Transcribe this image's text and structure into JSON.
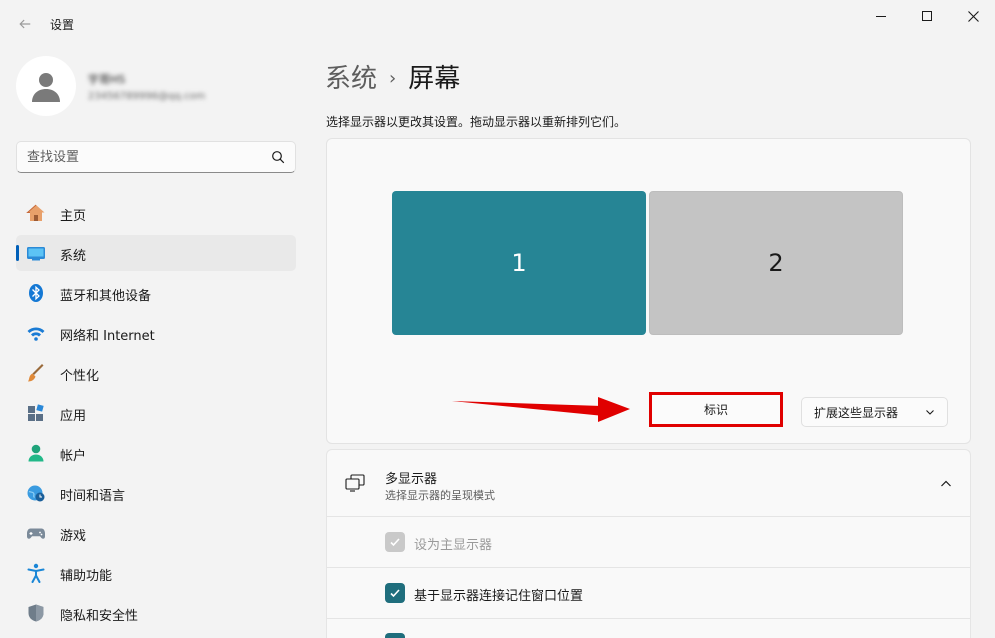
{
  "window": {
    "title": "设置"
  },
  "profile": {
    "name": "宇哥HS",
    "email": "23456789996@qq.com"
  },
  "search": {
    "placeholder": "查找设置"
  },
  "sidebar": {
    "items": [
      {
        "label": "主页",
        "icon": "home-icon"
      },
      {
        "label": "系统",
        "icon": "system-icon",
        "active": true
      },
      {
        "label": "蓝牙和其他设备",
        "icon": "bluetooth-icon"
      },
      {
        "label": "网络和 Internet",
        "icon": "wifi-icon"
      },
      {
        "label": "个性化",
        "icon": "brush-icon"
      },
      {
        "label": "应用",
        "icon": "apps-icon"
      },
      {
        "label": "帐户",
        "icon": "account-icon"
      },
      {
        "label": "时间和语言",
        "icon": "clock-globe-icon"
      },
      {
        "label": "游戏",
        "icon": "gamepad-icon"
      },
      {
        "label": "辅助功能",
        "icon": "accessibility-icon"
      },
      {
        "label": "隐私和安全性",
        "icon": "shield-icon"
      }
    ]
  },
  "breadcrumb": {
    "parent": "系统",
    "separator": "›",
    "current": "屏幕"
  },
  "main": {
    "description": "选择显示器以更改其设置。拖动显示器以重新排列它们。",
    "monitors": [
      {
        "label": "1",
        "selected": true,
        "color": "#268595"
      },
      {
        "label": "2",
        "selected": false,
        "color": "#c4c4c4"
      }
    ],
    "identify_label": "标识",
    "extend_dropdown_value": "扩展这些显示器",
    "multi_display": {
      "title": "多显示器",
      "subtitle": "选择显示器的呈现模式"
    },
    "options": [
      {
        "label": "设为主显示器",
        "checked": true,
        "disabled": true
      },
      {
        "label": "基于显示器连接记住窗口位置",
        "checked": true,
        "disabled": false
      }
    ]
  },
  "colors": {
    "accent": "#1f6e7d",
    "highlight_border": "#e00000",
    "arrow": "#e00000"
  }
}
